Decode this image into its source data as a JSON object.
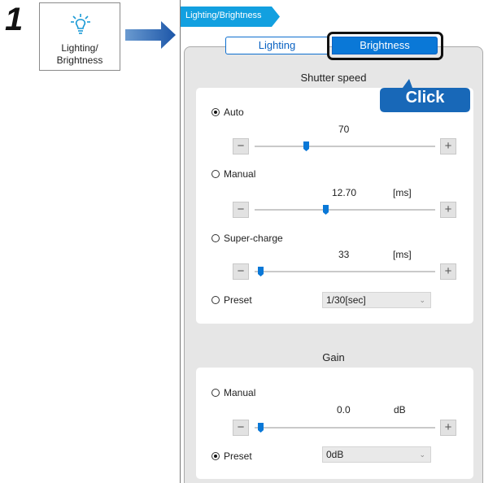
{
  "step": {
    "number": "1"
  },
  "icon_button": {
    "icon": "lightbulb-icon",
    "label_line1": "Lighting/",
    "label_line2": "Brightness"
  },
  "arrow": {
    "icon": "right-arrow-icon"
  },
  "window": {
    "title": "Lighting/Brightness"
  },
  "tabs": [
    {
      "label": "Lighting",
      "selected": false
    },
    {
      "label": "Brightness",
      "selected": true
    }
  ],
  "callout": {
    "text": "Click"
  },
  "shutter_speed": {
    "title": "Shutter speed",
    "auto": {
      "label": "Auto",
      "checked": true,
      "value": "70",
      "unit": "",
      "slider_fraction": 0.28
    },
    "manual": {
      "label": "Manual",
      "checked": false,
      "value": "12.70",
      "unit": "[ms]",
      "slider_fraction": 0.39
    },
    "supercharge": {
      "label": "Super-charge",
      "checked": false,
      "value": "33",
      "unit": "[ms]",
      "slider_fraction": 0.02
    },
    "preset": {
      "label": "Preset",
      "checked": false,
      "selected": "1/30[sec]"
    }
  },
  "gain": {
    "title": "Gain",
    "manual": {
      "label": "Manual",
      "checked": false,
      "value": "0.0",
      "unit": "dB",
      "slider_fraction": 0.02
    },
    "preset": {
      "label": "Preset",
      "checked": true,
      "selected": "0dB"
    }
  },
  "stepper": {
    "minus": "−",
    "plus": "+"
  },
  "colors": {
    "accent": "#0a78d7",
    "callout": "#1868b8",
    "panel_bg": "#e6e6e6",
    "title_bg": "#12a0e0"
  }
}
